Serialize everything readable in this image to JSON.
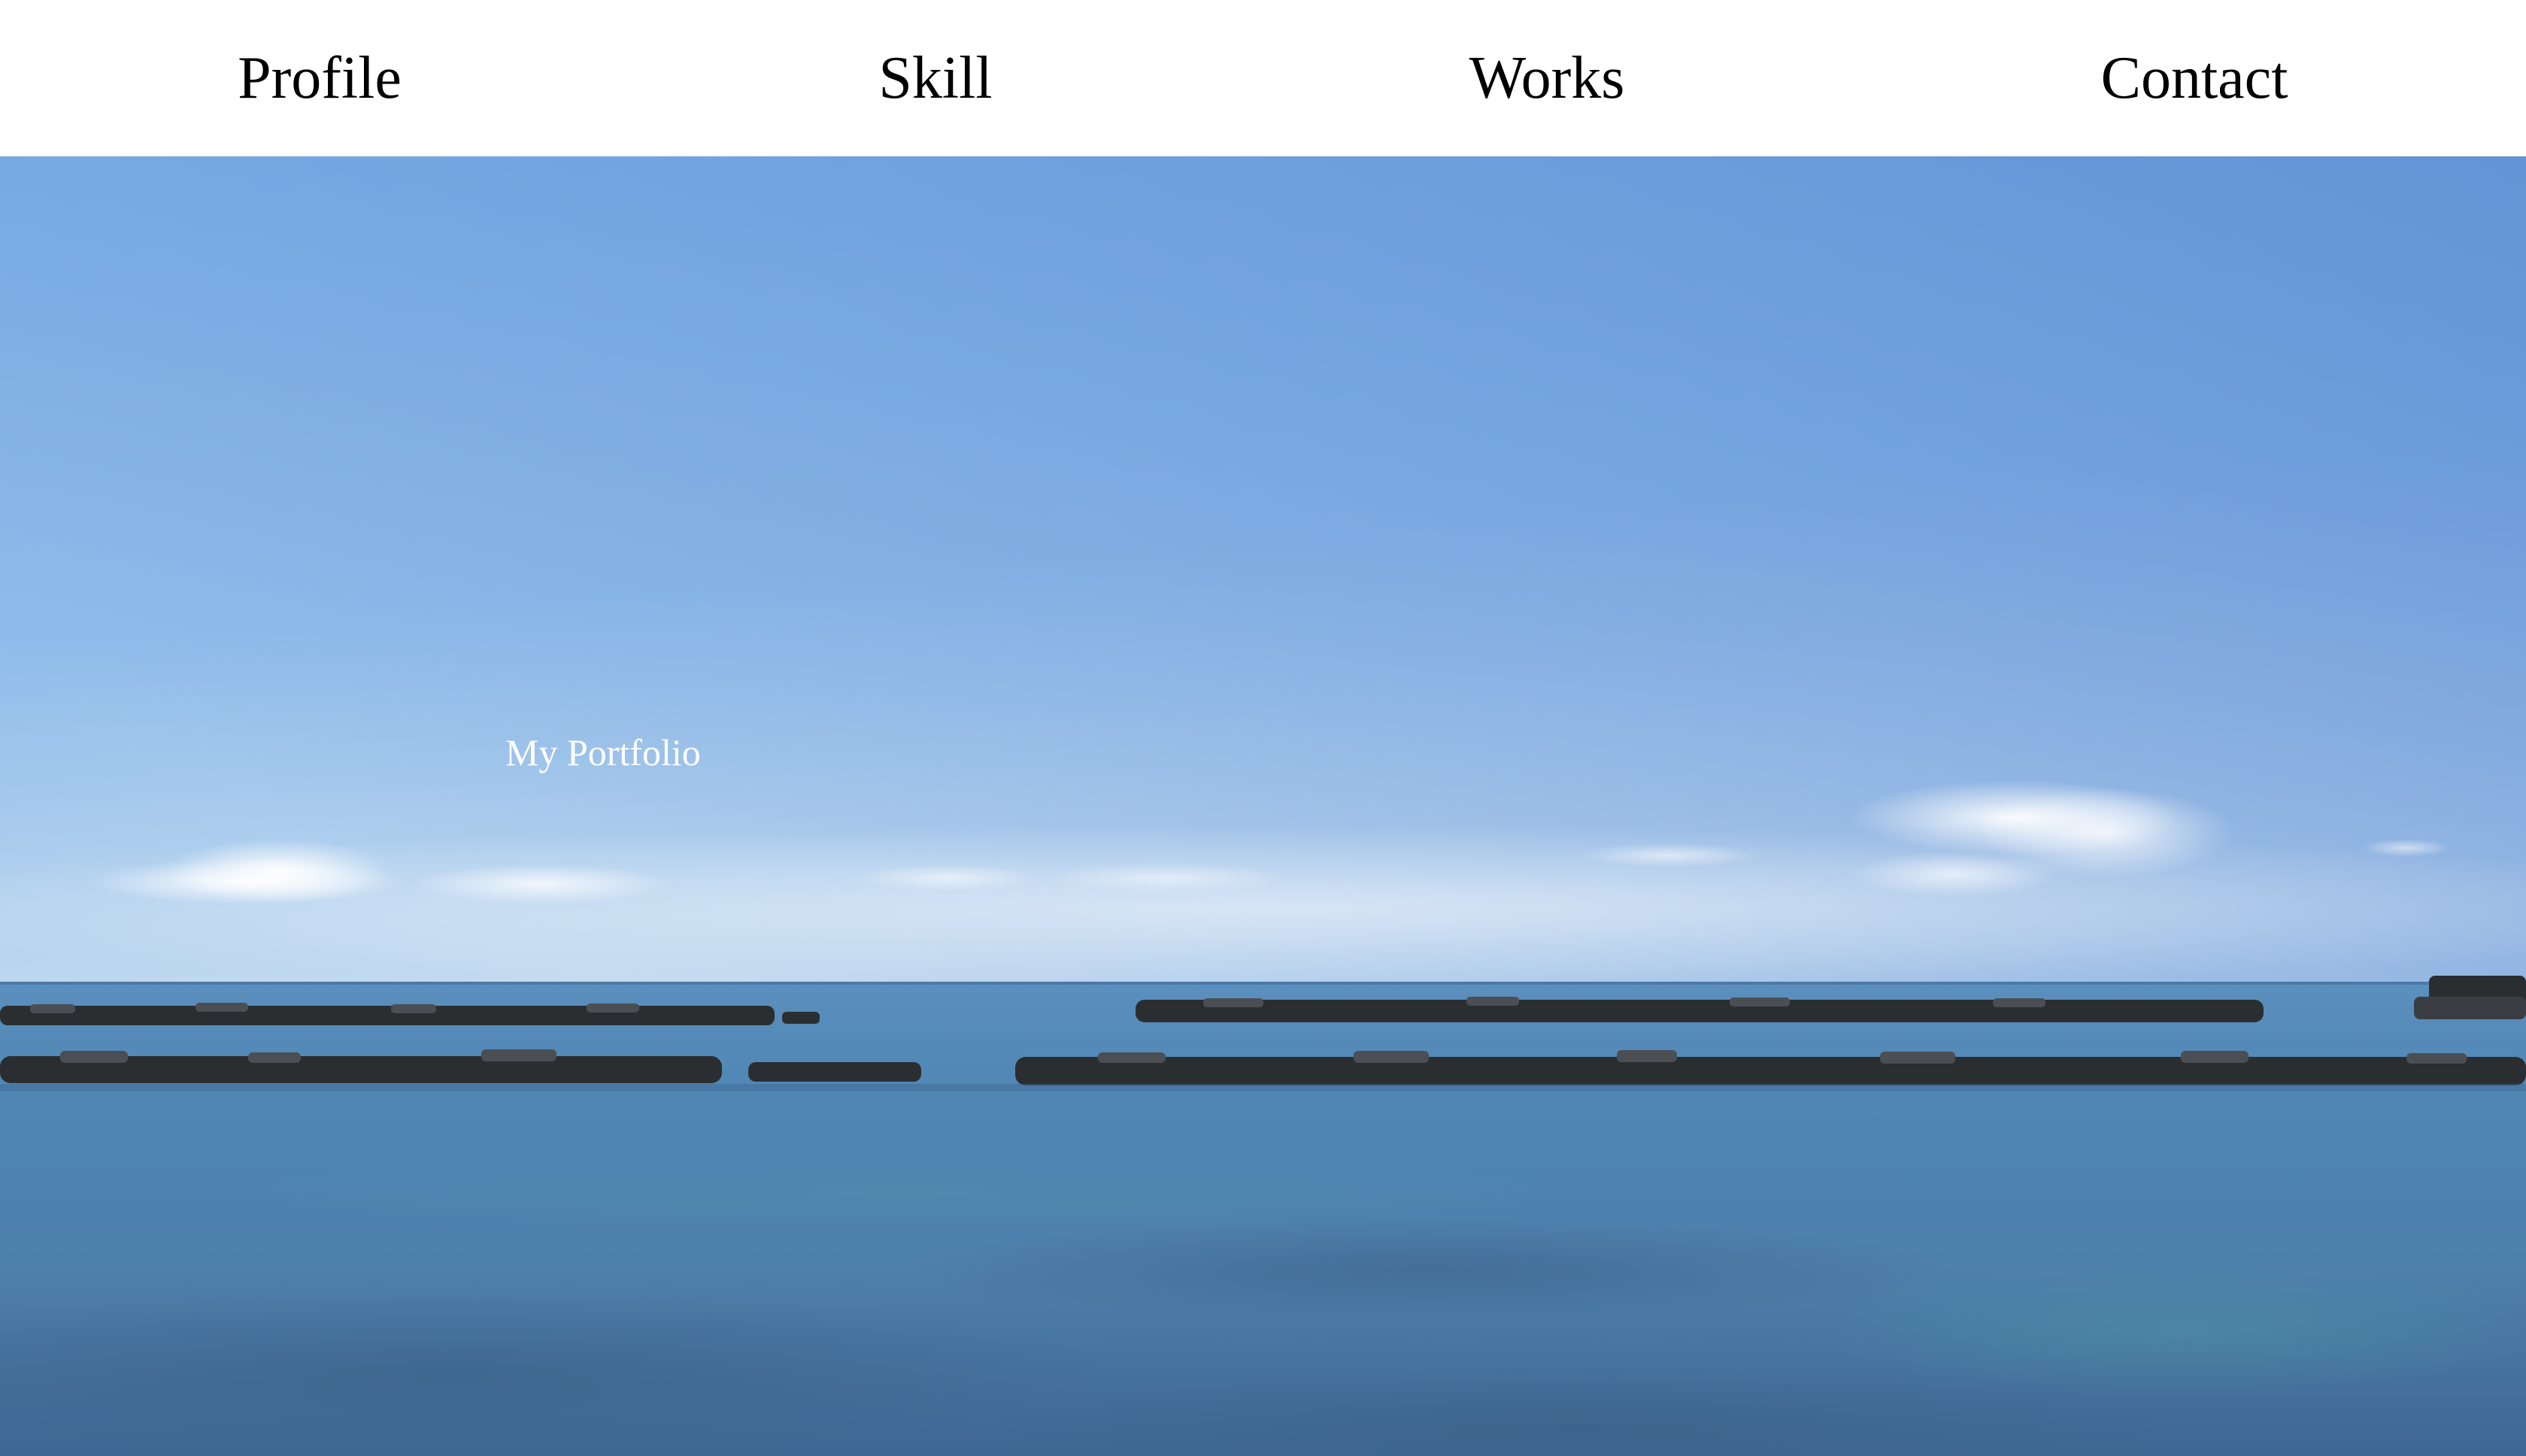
{
  "nav": {
    "items": [
      {
        "label": "Profile"
      },
      {
        "label": "Skill"
      },
      {
        "label": "Works"
      },
      {
        "label": "Contact"
      }
    ]
  },
  "hero": {
    "title": "My Portfolio"
  },
  "colors": {
    "nav_background": "#ffffff",
    "nav_text": "#000000",
    "hero_text": "#ffffff",
    "sky_top": "#6a9ad8",
    "sky_horizon": "#b9d4ee",
    "sea": "#4f7ea9",
    "rocks": "#2b2e31"
  }
}
